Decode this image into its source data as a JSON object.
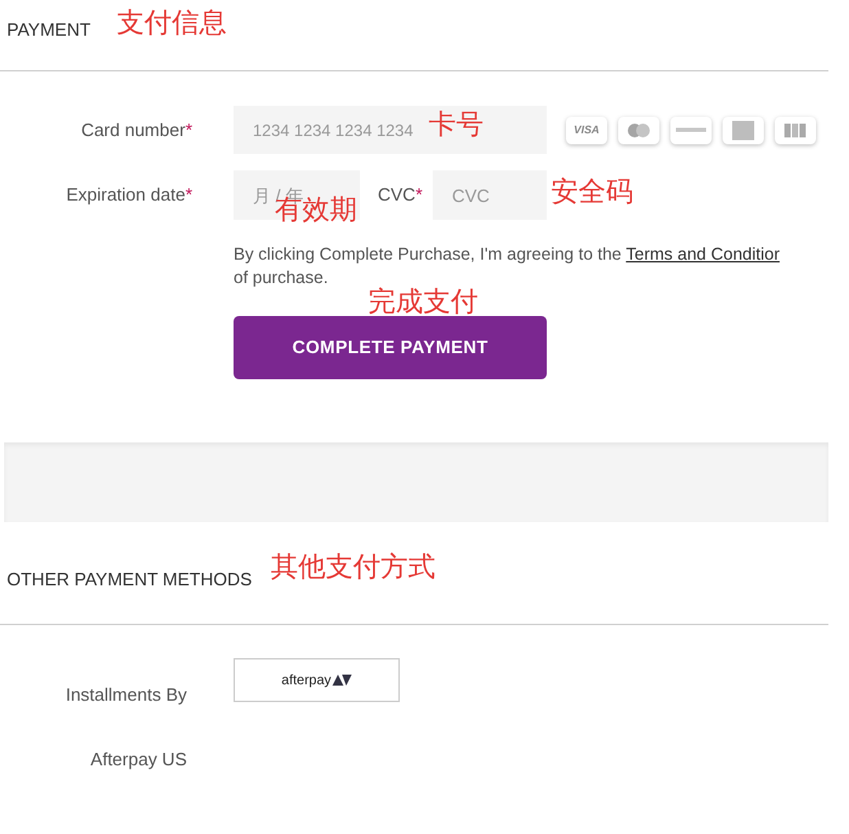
{
  "payment": {
    "title": "PAYMENT",
    "card_number": {
      "label": "Card number",
      "required_mark": "*",
      "placeholder": "1234 1234 1234 1234"
    },
    "card_logos": [
      {
        "kind": "text",
        "label": "VISA"
      },
      {
        "kind": "circles"
      },
      {
        "kind": "stripe"
      },
      {
        "kind": "square"
      },
      {
        "kind": "blocks"
      }
    ],
    "expiration": {
      "label": "Expiration date",
      "required_mark": "*",
      "placeholder": "月 / 年"
    },
    "cvc": {
      "label": "CVC",
      "required_mark": "*",
      "placeholder": "CVC"
    },
    "terms": {
      "before": "By clicking Complete Purchase, I'm agreeing to the ",
      "link": "Terms and Conditior",
      "after": "of purchase."
    },
    "button": "COMPLETE PAYMENT"
  },
  "other_methods": {
    "title": "OTHER PAYMENT METHODS",
    "label_1": "Installments By",
    "label_2": "Afterpay US",
    "afterpay": {
      "logo_text": "afterpay"
    }
  },
  "annotations": [
    {
      "text": "支付信息"
    },
    {
      "text": "卡号"
    },
    {
      "text": "有效期"
    },
    {
      "text": "安全码"
    },
    {
      "text": "完成支付"
    },
    {
      "text": "其他支付方式"
    }
  ]
}
